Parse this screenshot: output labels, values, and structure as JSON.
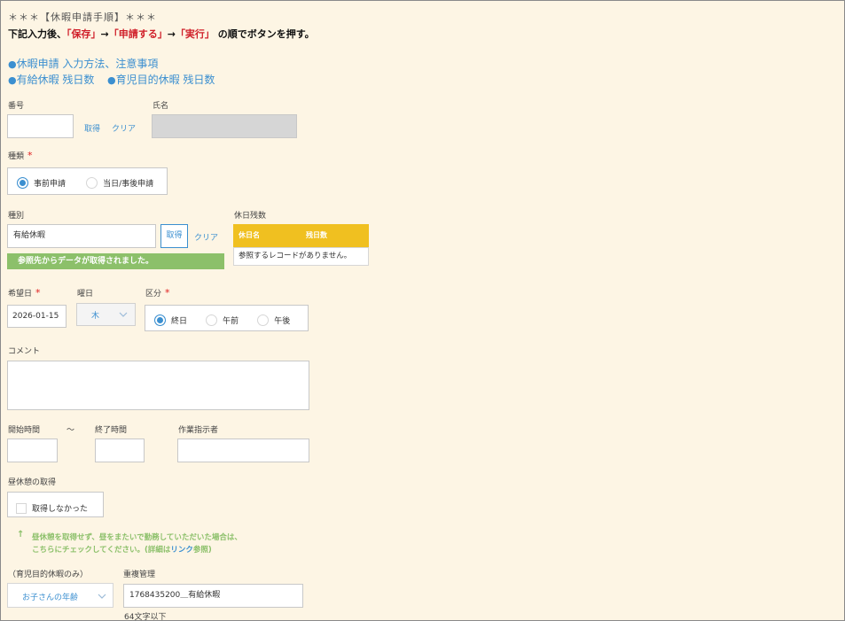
{
  "header": {
    "title": "＊＊＊【休暇申請手順】＊＊＊",
    "instr_prefix": "下記入力後、",
    "instr_save": "「保存」",
    "instr_arrow1": "→",
    "instr_apply": "「申請する」",
    "instr_arrow2": "→",
    "instr_exec": "「実行」",
    "instr_suffix": " の順でボタンを押す。"
  },
  "links": {
    "bullet": "●",
    "howto": "休暇申請 入力方法、注意事項",
    "paid_remaining": "有給休暇 残日数",
    "childcare_remaining": "育児目的休暇 残日数"
  },
  "employee": {
    "number_label": "番号",
    "number_value": "",
    "get_label": "取得",
    "clear_label": "クリア",
    "name_label": "氏名",
    "name_value": ""
  },
  "type": {
    "label": "種類",
    "required": "*",
    "options": [
      "事前申請",
      "当日/事後申請"
    ],
    "selected": 0
  },
  "category": {
    "label": "種別",
    "value": "有給休暇",
    "get_label": "取得",
    "clear_label": "クリア",
    "success_message": "参照先からデータが取得されました。"
  },
  "holiday_balance": {
    "label": "休日残数",
    "columns": [
      "休日名",
      "残日数"
    ],
    "empty_message": "参照するレコードがありません。"
  },
  "date": {
    "label": "希望日",
    "required": "*",
    "value": "2026-01-15"
  },
  "weekday": {
    "label": "曜日",
    "value": "木"
  },
  "division": {
    "label": "区分",
    "required": "*",
    "options": [
      "終日",
      "午前",
      "午後"
    ],
    "selected": 0
  },
  "comment": {
    "label": "コメント",
    "value": ""
  },
  "time": {
    "start_label": "開始時間",
    "tilde": "～",
    "end_label": "終了時間",
    "start_value": "",
    "end_value": ""
  },
  "supervisor": {
    "label": "作業指示者",
    "value": ""
  },
  "lunch": {
    "label": "昼休憩の取得",
    "checkbox_label": "取得しなかった",
    "checked": false
  },
  "note": {
    "arrow": "↑",
    "line1": "昼休憩を取得せず、昼をまたいで勤務していただいた場合は、",
    "line2_prefix": "こちらにチェックしてください。(詳細は",
    "line2_link": "リンク",
    "line2_suffix": "参照)"
  },
  "childcare": {
    "label": "（育児目的休暇のみ）",
    "select_value": "お子さんの年齢"
  },
  "duplicate": {
    "label": "重複管理",
    "value": "1768435200＿有給休暇",
    "hint": "64文字以下"
  },
  "colors": {
    "accent": "#3b8fd0",
    "required": "#e02020",
    "success": "#8cc06a",
    "table_header": "#f0c020",
    "note_green": "#8cc06a",
    "background": "#fdf5e4"
  }
}
